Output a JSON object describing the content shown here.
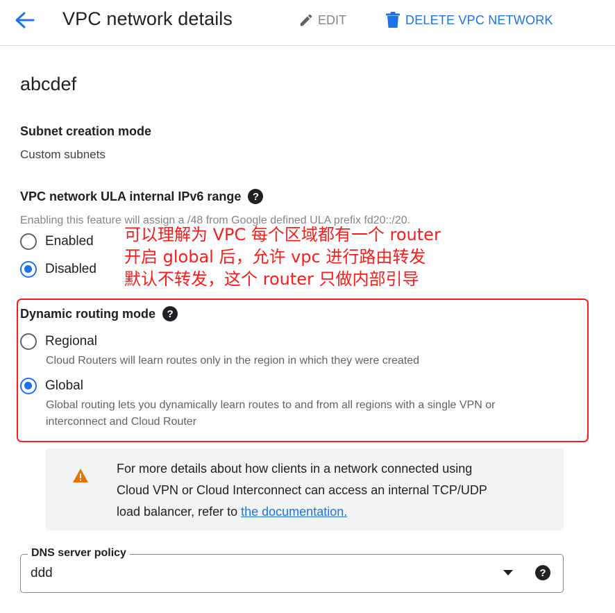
{
  "header": {
    "title": "VPC network details",
    "edit_label": "EDIT",
    "delete_label": "DELETE VPC NETWORK"
  },
  "network": {
    "name": "abcdef"
  },
  "subnet": {
    "label": "Subnet creation mode",
    "value": "Custom subnets"
  },
  "ula": {
    "label": "VPC network ULA internal IPv6 range",
    "hint": "Enabling this feature will assign a /48 from Google defined ULA prefix fd20::/20.",
    "options": [
      {
        "label": "Enabled",
        "selected": false
      },
      {
        "label": "Disabled",
        "selected": true
      }
    ]
  },
  "annotation": {
    "lines": [
      "可以理解为 VPC 每个区域都有一个 router",
      "开启 global 后，允许 vpc 进行路由转发",
      "默认不转发，这个 router 只做内部引导"
    ],
    "color": "#ff1a1a"
  },
  "routing": {
    "label": "Dynamic routing mode",
    "options": [
      {
        "label": "Regional",
        "selected": false,
        "description": "Cloud Routers will learn routes only in the region in which they were created"
      },
      {
        "label": "Global",
        "selected": true,
        "description_line1": "Global routing lets you dynamically learn routes to and from all regions with a single VPN or",
        "description_line2": "interconnect and Cloud Router"
      }
    ]
  },
  "info": {
    "line1": "For more details about how clients in a network connected using",
    "line2": "Cloud VPN or Cloud Interconnect can access an internal TCP/UDP",
    "line3_prefix": "load balancer, refer to ",
    "link_text": "the documentation."
  },
  "dns": {
    "label": "DNS server policy",
    "value": "ddd"
  },
  "colors": {
    "accent": "#1a73e8",
    "warning": "#e37400",
    "annotation_red": "#ff1a1a"
  },
  "icons": {
    "back": "arrow-back-icon",
    "edit": "pencil-icon",
    "delete": "trash-icon",
    "help": "help-circle-icon",
    "warning": "warning-triangle-icon",
    "dropdown": "caret-down-icon"
  }
}
